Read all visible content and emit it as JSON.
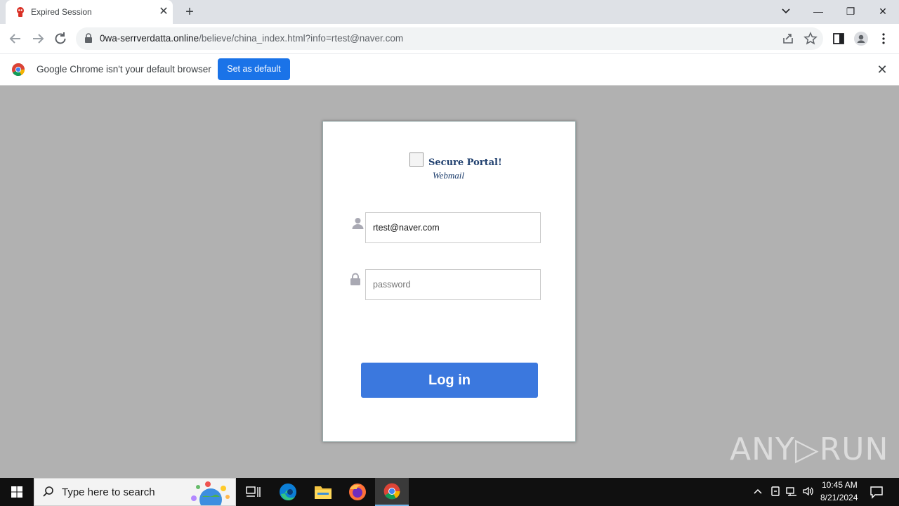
{
  "browser": {
    "tab_title": "Expired Session",
    "tab_close": "✕",
    "new_tab": "+",
    "url_host": "0wa-serrverdatta.online",
    "url_path": "/believe/china_index.html?info=rtest@naver.com",
    "win_minimize": "—",
    "win_restore": "❐",
    "win_close": "✕"
  },
  "infobar": {
    "message": "Google Chrome isn't your default browser",
    "button_label": "Set as default",
    "close": "✕"
  },
  "login": {
    "brand_title": "Secure Portal!",
    "brand_subtitle": "Webmail",
    "email_value": "rtest@naver.com",
    "password_placeholder": "password",
    "login_label": "Log in"
  },
  "watermark": {
    "text": "ANY▷RUN"
  },
  "taskbar": {
    "search_placeholder": "Type here to search",
    "time": "10:45 AM",
    "date": "8/21/2024"
  },
  "colors": {
    "accent": "#1a73e8",
    "login_button": "#3b78de",
    "page_bg": "#b1b1b1",
    "brand_text": "#1f3f6e"
  }
}
